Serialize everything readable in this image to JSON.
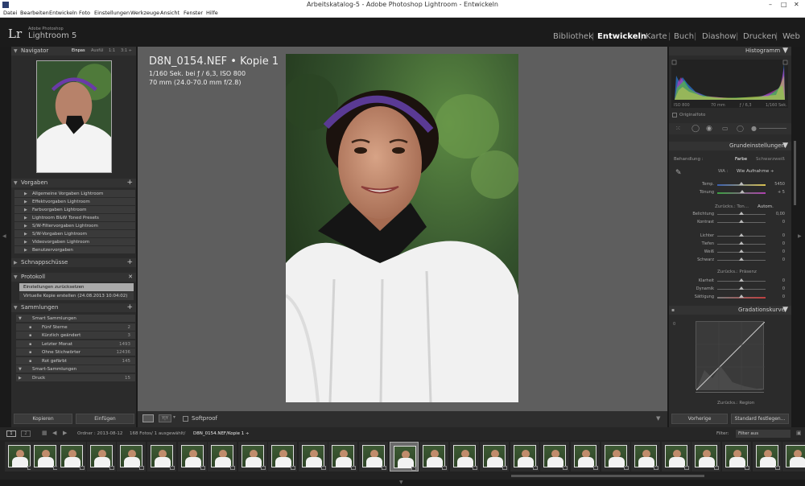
{
  "window": {
    "title": "Arbeitskatalog-5 - Adobe Photoshop Lightroom - Entwickeln"
  },
  "menu": [
    "Datei",
    "Bearbeiten",
    "Entwickeln",
    "Foto",
    "Einstellungen",
    "Werkzeuge",
    "Ansicht",
    "Fenster",
    "Hilfe"
  ],
  "brand": {
    "logo": "Lr",
    "sub": "Adobe Photoshop",
    "name": "Lightroom 5"
  },
  "modules": [
    "Bibliothek",
    "Entwickeln",
    "Karte",
    "Buch",
    "Diashow",
    "Drucken",
    "Web"
  ],
  "active_module": "Entwickeln",
  "navigator": {
    "title": "Navigator",
    "zoom": [
      "Einpas",
      "Ausfül",
      "1:1",
      "3:1 ÷"
    ]
  },
  "presets": {
    "title": "Vorgaben",
    "items": [
      "Allgemeine Vorgaben Lightroom",
      "Effektvorgaben Lightroom",
      "Farbvorgaben Lightroom",
      "Lightroom B&W Toned Presets",
      "S/W-Filtervorgaben Lightroom",
      "S/W-Vorgaben Lightroom",
      "Videovorgaben Lightroom",
      "Benutzervorgaben"
    ]
  },
  "snapshots": {
    "title": "Schnappschüsse"
  },
  "history": {
    "title": "Protokoll",
    "items": [
      "Einstellungen zurücksetzen",
      "Virtuelle Kopie erstellen (24.08.2013 10:04:02)"
    ]
  },
  "collections": {
    "title": "Sammlungen",
    "tree": [
      {
        "label": "Smart Sammlungen",
        "count": "",
        "level": 1
      },
      {
        "label": "Fünf Sterne",
        "count": "2",
        "level": 2
      },
      {
        "label": "Kürzlich geändert",
        "count": "3",
        "level": 2
      },
      {
        "label": "Letzter Monat",
        "count": "1493",
        "level": 2
      },
      {
        "label": "Ohne Stichwörter",
        "count": "12436",
        "level": 2
      },
      {
        "label": "Rot gefärbt",
        "count": "145",
        "level": 2
      },
      {
        "label": "Smart-Sammlungen",
        "count": "",
        "level": 1
      },
      {
        "label": "Druck",
        "count": "15",
        "level": 1
      }
    ]
  },
  "left_buttons": {
    "copy": "Kopieren",
    "paste": "Einfügen"
  },
  "photo_info": {
    "name": "D8N_0154.NEF  •  Kopie 1",
    "line1": "1/160 Sek. bei ƒ / 6,3, ISO 800",
    "line2": "70 mm (24.0-70.0 mm f/2.8)"
  },
  "toolbar": {
    "softproof": "Softproof"
  },
  "histogram": {
    "title": "Histogramm",
    "iso": "ISO 800",
    "focal": "70 mm",
    "aperture": "ƒ / 6,3",
    "shutter": "1/160 Sek.",
    "original": "Originalfoto"
  },
  "basic": {
    "title": "Grundeinstellungen",
    "treatment_label": "Behandlung :",
    "color": "Farbe",
    "bw": "Schwarzweiß",
    "wb_label": "WA :",
    "wb_value": "Wie Aufnahme ÷",
    "temp_label": "Temp.",
    "temp_value": "5450",
    "tint_label": "Tönung",
    "tint_value": "+ 5",
    "tone_label": "Zurücks.: Ton...",
    "auto": "Autom.",
    "exposure_label": "Belichtung",
    "exposure_value": "0,00",
    "contrast_label": "Kontrast",
    "contrast_value": "0",
    "highlights_label": "Lichter",
    "highlights_value": "0",
    "shadows_label": "Tiefen",
    "shadows_value": "0",
    "whites_label": "Weiß",
    "whites_value": "0",
    "blacks_label": "Schwarz",
    "blacks_value": "0",
    "presence_label": "Zurücks.: Präsenz",
    "clarity_label": "Klarheit",
    "clarity_value": "0",
    "vibrance_label": "Dynamik",
    "vibrance_value": "0",
    "saturation_label": "Sättigung",
    "saturation_value": "0"
  },
  "tone_curve": {
    "title": "Gradationskurve",
    "region": "Zurücks.: Region"
  },
  "right_buttons": {
    "previous": "Vorherige",
    "reset": "Standard festlegen..."
  },
  "filmstrip": {
    "pages": [
      "1",
      "2"
    ],
    "source": "Ordner : 2013-08-12",
    "count": "168 Fotos/ 1 ausgewählt/",
    "file": "D8N_0154.NEF/Kopie 1 ÷",
    "filter_label": "Filter:",
    "filter_value": "Filter aus"
  },
  "colors": {
    "accent": "#ffffff",
    "panel": "#2b2b2b",
    "center_bg": "#5e5e5e"
  }
}
